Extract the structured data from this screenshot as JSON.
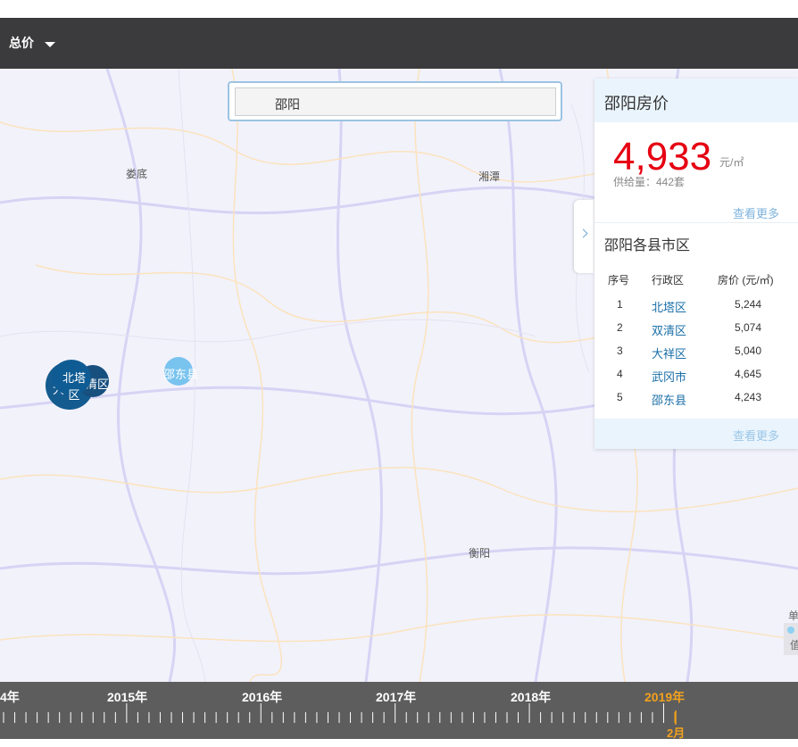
{
  "toolbar": {
    "metric_label": "总价",
    "caret_icon": "chevron-down-icon"
  },
  "search": {
    "value": "邵阳"
  },
  "map": {
    "labels": [
      "娄底",
      "湘潭",
      "衡阳"
    ],
    "bubbles": [
      {
        "name": "北塔区",
        "color": "#0f5b93"
      },
      {
        "name": "大祥区",
        "short": "大",
        "color": "#145b8f"
      },
      {
        "name": "双清区",
        "short": "清区",
        "color": "#174f7e"
      },
      {
        "name": "邵东县",
        "color": "#79c3ef"
      }
    ]
  },
  "panel": {
    "title": "邵阳房价",
    "price": "4,933",
    "unit": "元/㎡",
    "supply": "供给量：442套",
    "more": "查看更多",
    "district_title": "邵阳各县市区",
    "columns": [
      "序号",
      "行政区",
      "房价 (元/㎡)"
    ],
    "rows": [
      {
        "rank": "1",
        "district": "北塔区",
        "price": "5,244"
      },
      {
        "rank": "2",
        "district": "双清区",
        "price": "5,074"
      },
      {
        "rank": "3",
        "district": "大祥区",
        "price": "5,040"
      },
      {
        "rank": "4",
        "district": "武冈市",
        "price": "4,645"
      },
      {
        "rank": "5",
        "district": "邵东县",
        "price": "4,243"
      }
    ],
    "footer_more": "查看更多",
    "toggle_icon": "chevron-right-icon"
  },
  "legend": {
    "title": "单",
    "item": "值"
  },
  "timeline": {
    "years": [
      "4年",
      "2015年",
      "2016年",
      "2017年",
      "2018年",
      "2019年"
    ],
    "active_year": "2019年",
    "active_month": "2月",
    "colors": {
      "active": "#f3a21c",
      "bar": "#5d5d5e"
    }
  }
}
